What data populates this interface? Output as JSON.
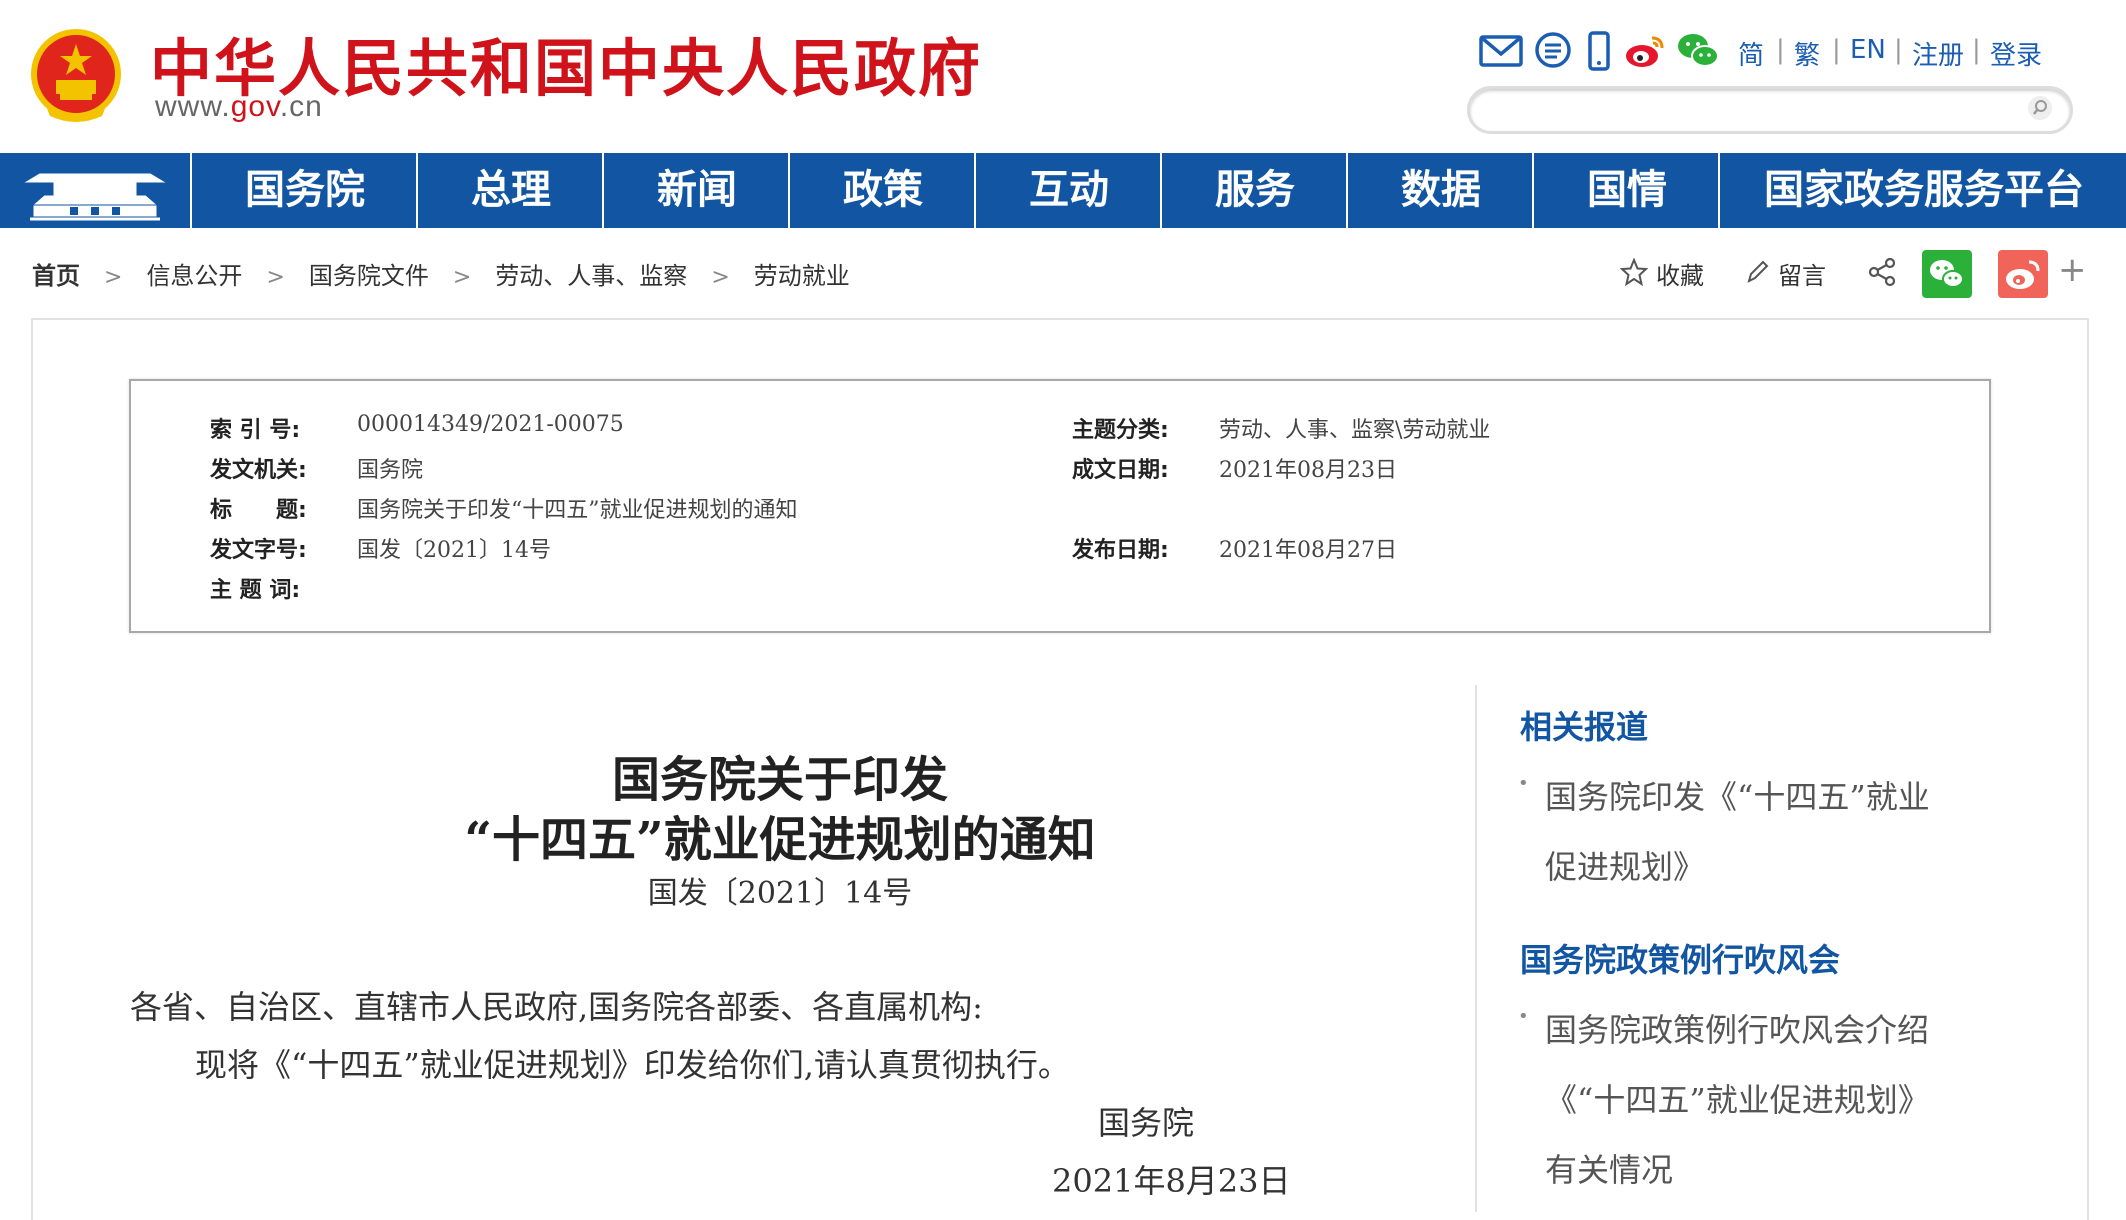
{
  "header": {
    "site_title": "中华人民共和国中央人民政府",
    "site_url_prefix": "www.",
    "site_url_brand": "gov",
    "site_url_suffix": ".cn",
    "top_links": [
      "简",
      "繁",
      "EN",
      "注册",
      "登录"
    ],
    "separator": "|",
    "search_placeholder": ""
  },
  "nav": {
    "items": [
      "国务院",
      "总理",
      "新闻",
      "政策",
      "互动",
      "服务",
      "数据",
      "国情",
      "国家政务服务平台"
    ]
  },
  "breadcrumb": {
    "items": [
      "首页",
      "信息公开",
      "国务院文件",
      "劳动、人事、监察",
      "劳动就业"
    ],
    "separator": ">"
  },
  "actions": {
    "favorite": "收藏",
    "comment": "留言",
    "more": "+"
  },
  "meta": {
    "index_label": "索 引 号:",
    "index_value": "000014349/2021-00075",
    "topic_label": "主题分类:",
    "topic_value": "劳动、人事、监察\\劳动就业",
    "issuer_label": "发文机关:",
    "issuer_value": "国务院",
    "written_label": "成文日期:",
    "written_value": "2021年08月23日",
    "title_label": "标　　题:",
    "title_value": "国务院关于印发“十四五”就业促进规划的通知",
    "docno_label": "发文字号:",
    "docno_value": "国发〔2021〕14号",
    "published_label": "发布日期:",
    "published_value": "2021年08月27日",
    "keywords_label": "主 题 词:",
    "keywords_value": ""
  },
  "document": {
    "title_line1": "国务院关于印发",
    "title_line2": "“十四五”就业促进规划的通知",
    "number": "国发〔2021〕14号",
    "salutation": "各省、自治区、直辖市人民政府,国务院各部委、各直属机构:",
    "body": "现将《“十四五”就业促进规划》印发给你们,请认真贯彻执行。",
    "signer": "国务院",
    "date": "2021年8月23日"
  },
  "sidebar": {
    "section1_title": "相关报道",
    "section1_link_line1": "国务院印发《“十四五”就业",
    "section1_link_line2": "促进规划》",
    "section2_title": "国务院政策例行吹风会",
    "section2_link_line1": "国务院政策例行吹风会介绍",
    "section2_link_line2": "《“十四五”就业促进规划》",
    "section2_link_line3": "有关情况"
  },
  "colors": {
    "brand_red": "#d0121b",
    "nav_blue": "#1256a3",
    "wechat_green": "#2bb13a",
    "weibo_orange": "#f0645a"
  }
}
